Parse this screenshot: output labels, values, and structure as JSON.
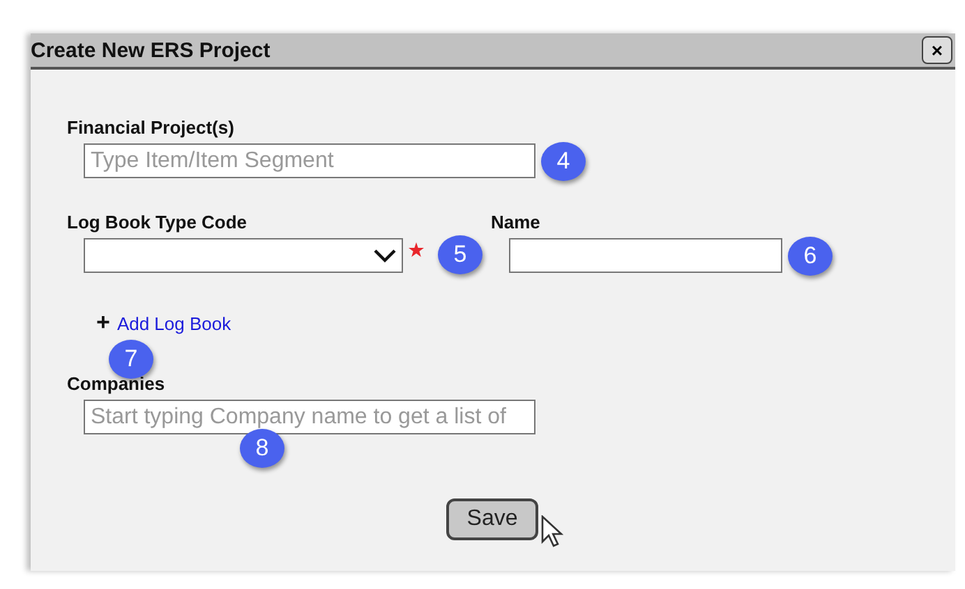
{
  "window": {
    "title": "Create New ERS Project",
    "close_label": "×"
  },
  "fields": [
    {
      "kind": "text",
      "label": "Financial Project(s)",
      "placeholder": "Type Item/Item Segment",
      "badge": "4"
    },
    {
      "kind": "select",
      "label": "Log Book Type Code",
      "required": true,
      "badge": "5"
    },
    {
      "kind": "text",
      "label": "Name",
      "badge": "6"
    }
  ],
  "add_link": {
    "icon": "+",
    "label": "Add Log Book",
    "badge": "7"
  },
  "companies": {
    "kind": "text",
    "label": "Companies",
    "placeholder": "Start typing Company name to get a list of",
    "badge": "8"
  },
  "buttons": [
    "Save"
  ]
}
